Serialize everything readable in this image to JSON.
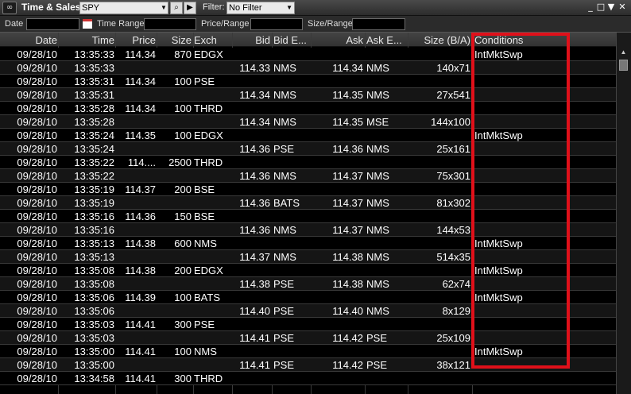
{
  "window": {
    "title": "Time & Sales",
    "symbol": "SPY",
    "filter_label": "Filter:",
    "filter_value": "No Filter"
  },
  "filters": {
    "date_label": "Date",
    "time_range_label": "Time Range",
    "price_range_label": "Price/Range",
    "size_range_label": "Size/Range"
  },
  "columns": [
    "Date",
    "Time",
    "Price",
    "Size",
    "Exch",
    "Bid",
    "Bid E...",
    "Ask",
    "Ask E...",
    "Size (B/A)",
    "Conditions"
  ],
  "rows": [
    [
      "09/28/10",
      "13:35:33",
      "114.34",
      "870",
      "EDGX",
      "",
      "",
      "",
      "",
      "",
      "IntMktSwp"
    ],
    [
      "09/28/10",
      "13:35:33",
      "",
      "",
      "",
      "114.33",
      "NMS",
      "114.34",
      "NMS",
      "140x71",
      ""
    ],
    [
      "09/28/10",
      "13:35:31",
      "114.34",
      "100",
      "PSE",
      "",
      "",
      "",
      "",
      "",
      ""
    ],
    [
      "09/28/10",
      "13:35:31",
      "",
      "",
      "",
      "114.34",
      "NMS",
      "114.35",
      "NMS",
      "27x541",
      ""
    ],
    [
      "09/28/10",
      "13:35:28",
      "114.34",
      "100",
      "THRD",
      "",
      "",
      "",
      "",
      "",
      ""
    ],
    [
      "09/28/10",
      "13:35:28",
      "",
      "",
      "",
      "114.34",
      "NMS",
      "114.35",
      "MSE",
      "144x100",
      ""
    ],
    [
      "09/28/10",
      "13:35:24",
      "114.35",
      "100",
      "EDGX",
      "",
      "",
      "",
      "",
      "",
      "IntMktSwp"
    ],
    [
      "09/28/10",
      "13:35:24",
      "",
      "",
      "",
      "114.36",
      "PSE",
      "114.36",
      "NMS",
      "25x161",
      ""
    ],
    [
      "09/28/10",
      "13:35:22",
      "114....",
      "2500",
      "THRD",
      "",
      "",
      "",
      "",
      "",
      ""
    ],
    [
      "09/28/10",
      "13:35:22",
      "",
      "",
      "",
      "114.36",
      "NMS",
      "114.37",
      "NMS",
      "75x301",
      ""
    ],
    [
      "09/28/10",
      "13:35:19",
      "114.37",
      "200",
      "BSE",
      "",
      "",
      "",
      "",
      "",
      ""
    ],
    [
      "09/28/10",
      "13:35:19",
      "",
      "",
      "",
      "114.36",
      "BATS",
      "114.37",
      "NMS",
      "81x302",
      ""
    ],
    [
      "09/28/10",
      "13:35:16",
      "114.36",
      "150",
      "BSE",
      "",
      "",
      "",
      "",
      "",
      ""
    ],
    [
      "09/28/10",
      "13:35:16",
      "",
      "",
      "",
      "114.36",
      "NMS",
      "114.37",
      "NMS",
      "144x53",
      ""
    ],
    [
      "09/28/10",
      "13:35:13",
      "114.38",
      "600",
      "NMS",
      "",
      "",
      "",
      "",
      "",
      "IntMktSwp"
    ],
    [
      "09/28/10",
      "13:35:13",
      "",
      "",
      "",
      "114.37",
      "NMS",
      "114.38",
      "NMS",
      "514x35",
      ""
    ],
    [
      "09/28/10",
      "13:35:08",
      "114.38",
      "200",
      "EDGX",
      "",
      "",
      "",
      "",
      "",
      "IntMktSwp"
    ],
    [
      "09/28/10",
      "13:35:08",
      "",
      "",
      "",
      "114.38",
      "PSE",
      "114.38",
      "NMS",
      "62x74",
      ""
    ],
    [
      "09/28/10",
      "13:35:06",
      "114.39",
      "100",
      "BATS",
      "",
      "",
      "",
      "",
      "",
      "IntMktSwp"
    ],
    [
      "09/28/10",
      "13:35:06",
      "",
      "",
      "",
      "114.40",
      "PSE",
      "114.40",
      "NMS",
      "8x129",
      ""
    ],
    [
      "09/28/10",
      "13:35:03",
      "114.41",
      "300",
      "PSE",
      "",
      "",
      "",
      "",
      "",
      ""
    ],
    [
      "09/28/10",
      "13:35:03",
      "",
      "",
      "",
      "114.41",
      "PSE",
      "114.42",
      "PSE",
      "25x109",
      ""
    ],
    [
      "09/28/10",
      "13:35:00",
      "114.41",
      "100",
      "NMS",
      "",
      "",
      "",
      "",
      "",
      "IntMktSwp"
    ],
    [
      "09/28/10",
      "13:35:00",
      "",
      "",
      "",
      "114.41",
      "PSE",
      "114.42",
      "PSE",
      "38x121",
      ""
    ],
    [
      "09/28/10",
      "13:34:58",
      "114.41",
      "300",
      "THRD",
      "",
      "",
      "",
      "",
      "",
      ""
    ]
  ],
  "colors": {
    "highlight": "#e0101a"
  }
}
